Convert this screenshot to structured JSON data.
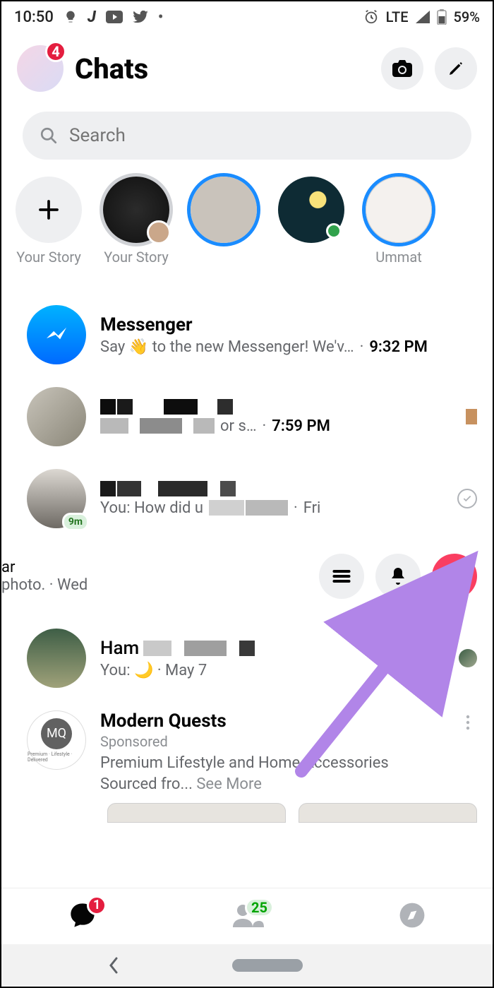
{
  "status": {
    "time": "10:50",
    "network": "LTE",
    "battery": "59%"
  },
  "header": {
    "title": "Chats",
    "badge": "4"
  },
  "search": {
    "placeholder": "Search"
  },
  "stories": [
    {
      "label": "Your Story",
      "type": "add"
    },
    {
      "label": "Your Story",
      "type": "gray"
    },
    {
      "label": "",
      "type": "blue"
    },
    {
      "label": "",
      "type": "plain_online"
    },
    {
      "label": "Ummat",
      "type": "blue_light"
    }
  ],
  "chats": [
    {
      "name": "Messenger",
      "preview": "Say 👋 to the new Messenger! We'v…",
      "time": "9:32 PM",
      "bold": true
    },
    {
      "name_hidden": true,
      "preview_tail": "  or s…",
      "time": "7:59 PM",
      "bold": true
    },
    {
      "you_prefix": "You: How did u",
      "time": "Fri",
      "activity": "9m",
      "seen_ring": true
    }
  ],
  "swipe": {
    "line1_tail": "ar",
    "line2": "photo. · Wed"
  },
  "row_ham": {
    "name_prefix": "Ham",
    "preview": "You: 🌙 · May 7"
  },
  "sponsor": {
    "name": "Modern Quests",
    "tag": "Sponsored",
    "initials": "MQ",
    "subline": "Premium · Lifestyle · Delivered",
    "text": "Premium Lifestyle and Home Accessories Sourced fro... ",
    "see_more": "See More"
  },
  "nav": {
    "chats_badge": "1",
    "people_badge": "25"
  }
}
